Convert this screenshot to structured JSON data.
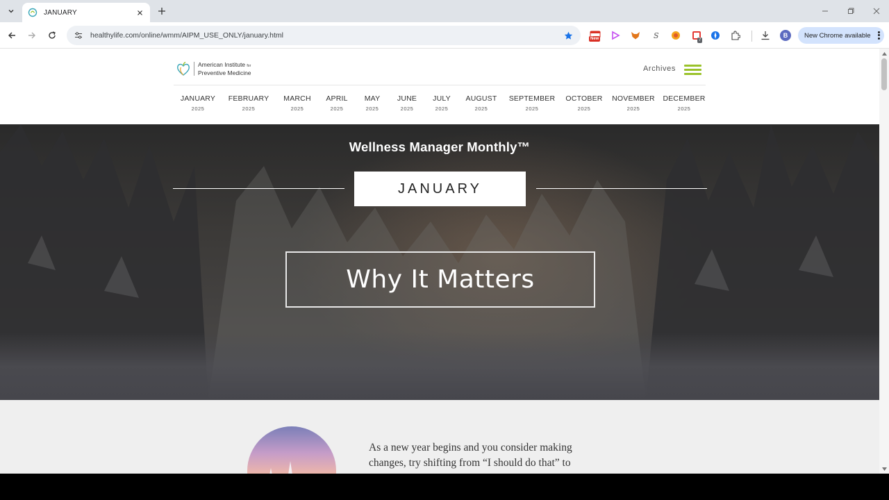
{
  "browser": {
    "tab_title": "JANUARY",
    "url": "healthylife.com/online/wmm/AIPM_USE_ONLY/january.html",
    "new_chrome_label": "New Chrome available",
    "profile_initial": "B",
    "badge_new": "New",
    "badge_count": "7"
  },
  "header": {
    "logo_line1": "American Institute",
    "logo_for": "for",
    "logo_line2": "Preventive Medicine",
    "archives_label": "Archives",
    "accent_color": "#9ac22a"
  },
  "months": [
    {
      "label": "JANUARY",
      "year": "2025"
    },
    {
      "label": "FEBRUARY",
      "year": "2025"
    },
    {
      "label": "MARCH",
      "year": "2025"
    },
    {
      "label": "APRIL",
      "year": "2025"
    },
    {
      "label": "MAY",
      "year": "2025"
    },
    {
      "label": "JUNE",
      "year": "2025"
    },
    {
      "label": "JULY",
      "year": "2025"
    },
    {
      "label": "AUGUST",
      "year": "2025"
    },
    {
      "label": "SEPTEMBER",
      "year": "2025"
    },
    {
      "label": "OCTOBER",
      "year": "2025"
    },
    {
      "label": "NOVEMBER",
      "year": "2025"
    },
    {
      "label": "DECEMBER",
      "year": "2025"
    }
  ],
  "hero": {
    "title": "Wellness Manager Monthly™",
    "month": "JANUARY",
    "section_title": "Why It Matters"
  },
  "content": {
    "intro_text": "As a new year begins and you consider making changes, try shifting from “I should do that” to"
  }
}
